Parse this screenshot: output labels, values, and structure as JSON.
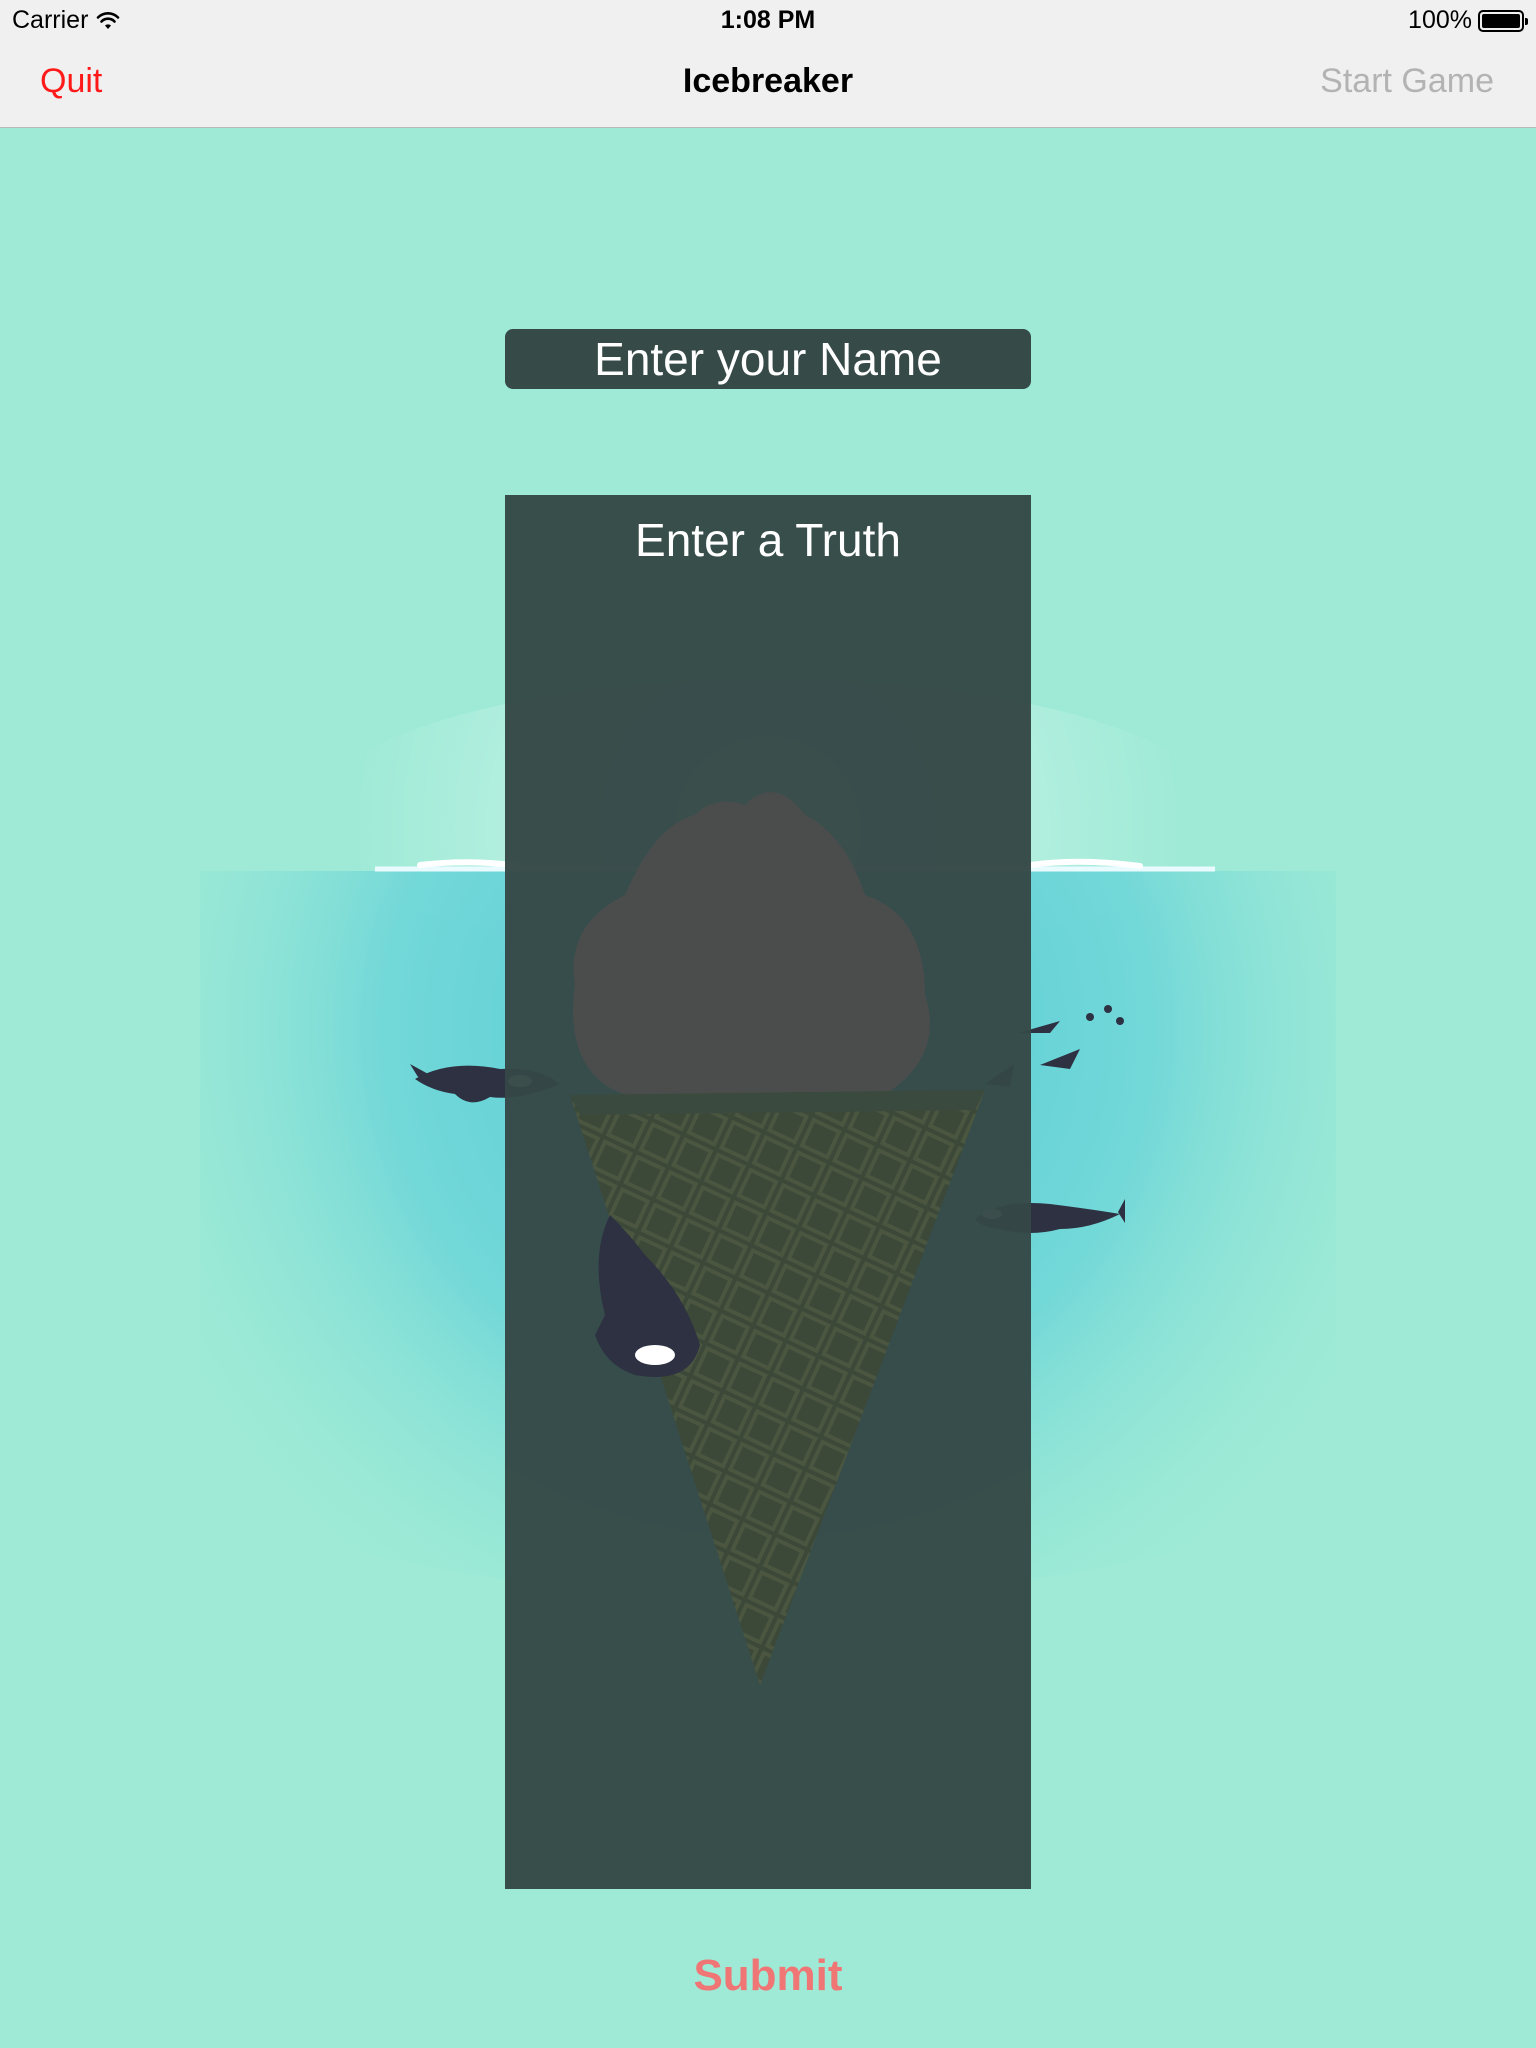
{
  "status_bar": {
    "carrier": "Carrier",
    "time": "1:08 PM",
    "battery": "100%",
    "wifi_icon": "wifi-icon",
    "battery_icon": "battery-icon"
  },
  "nav": {
    "quit_label": "Quit",
    "title": "Icebreaker",
    "start_label": "Start Game"
  },
  "form": {
    "name_placeholder": "Enter your Name",
    "truth_placeholder": "Enter a Truth",
    "submit_label": "Submit"
  },
  "colors": {
    "background": "#9eead6",
    "quit": "#ff1a1a",
    "start_disabled": "#b3b3b3",
    "field_bg": "#364a47",
    "submit": "#f07575"
  }
}
